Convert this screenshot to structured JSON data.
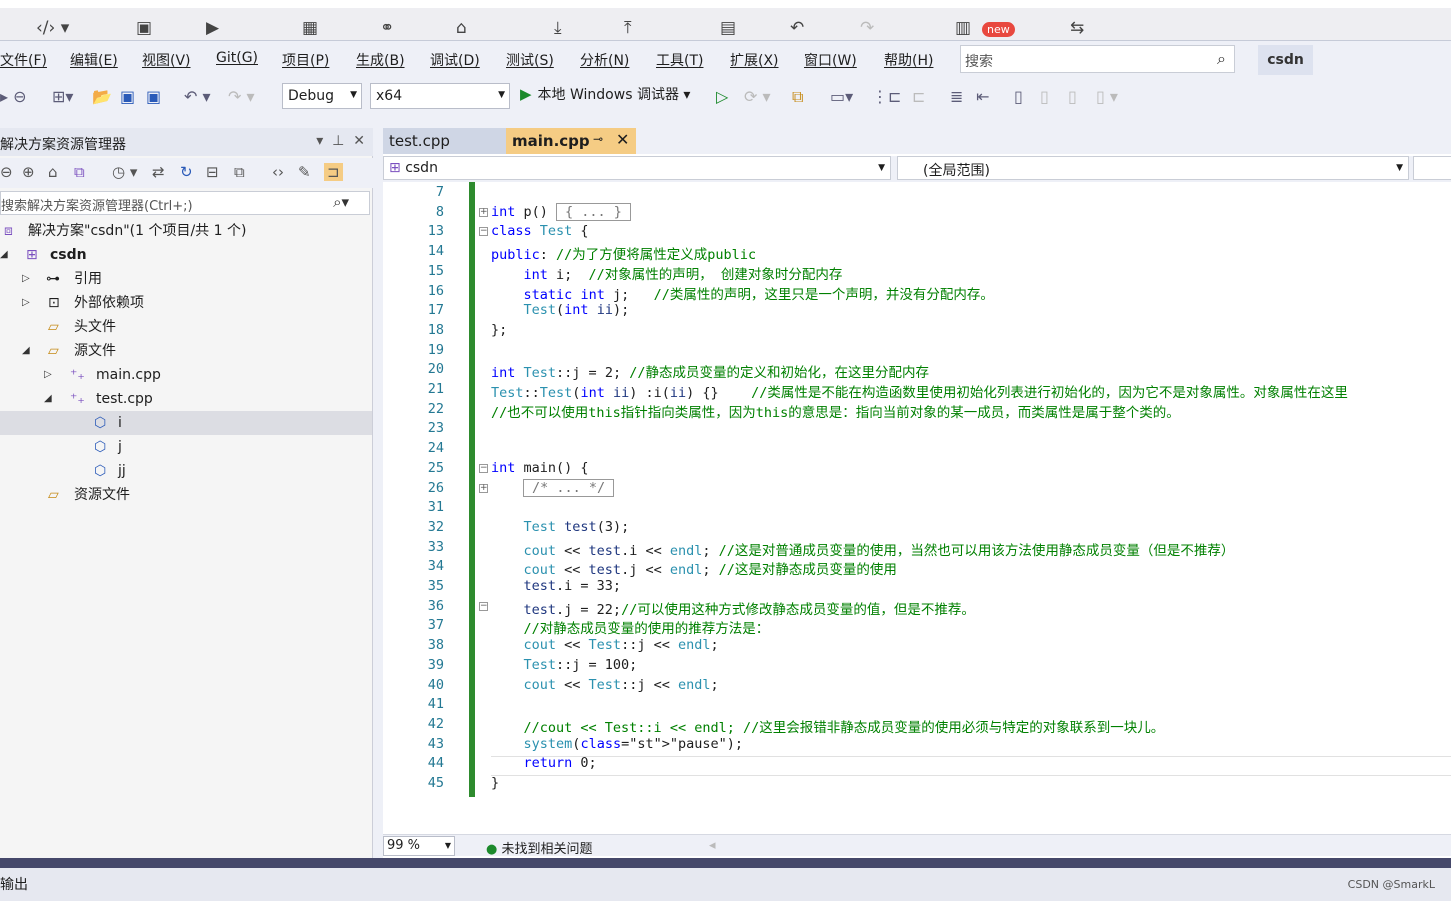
{
  "menu": [
    "文件(F)",
    "编辑(E)",
    "视图(V)",
    "Git(G)",
    "项目(P)",
    "生成(B)",
    "调试(D)",
    "测试(S)",
    "分析(N)",
    "工具(T)",
    "扩展(X)",
    "窗口(W)",
    "帮助(H)"
  ],
  "badge_new": "new",
  "search_placeholder": "搜索",
  "profile": "csdn",
  "toolbar": {
    "config": "Debug",
    "platform": "x64",
    "run_label": "本地 Windows 调试器"
  },
  "solution": {
    "title": "解决方案资源管理器",
    "search_placeholder": "搜索解决方案资源管理器(Ctrl+;)",
    "items": [
      "解决方案\"csdn\"(1 个项目/共 1 个)",
      "csdn",
      "引用",
      "外部依赖项",
      "头文件",
      "源文件",
      "main.cpp",
      "test.cpp",
      "i",
      "j",
      "jj",
      "资源文件"
    ]
  },
  "tabs": [
    "test.cpp",
    "main.cpp"
  ],
  "nav": {
    "project": "csdn",
    "scope": "(全局范围)"
  },
  "code_lines": [
    {
      "n": "7",
      "t": ""
    },
    {
      "n": "8",
      "t": "int p()"
    },
    {
      "n": "13",
      "t": "class Test {"
    },
    {
      "n": "14",
      "t": "public: //为了方便将属性定义成public"
    },
    {
      "n": "15",
      "t": "    int i;  //对象属性的声明， 创建对象时分配内存"
    },
    {
      "n": "16",
      "t": "    static int j;   //类属性的声明，这里只是一个声明，并没有分配内存。"
    },
    {
      "n": "17",
      "t": "    Test(int ii);"
    },
    {
      "n": "18",
      "t": "};"
    },
    {
      "n": "19",
      "t": ""
    },
    {
      "n": "20",
      "t": "int Test::j = 2; //静态成员变量的定义和初始化，在这里分配内存"
    },
    {
      "n": "21",
      "t": "Test::Test(int ii) :i(ii) {}    //类属性是不能在构造函数里使用初始化列表进行初始化的，因为它不是对象属性。对象属性在这里"
    },
    {
      "n": "22",
      "t": "//也不可以使用this指针指向类属性，因为this的意思是：指向当前对象的某一成员，而类属性是属于整个类的。"
    },
    {
      "n": "23",
      "t": ""
    },
    {
      "n": "24",
      "t": ""
    },
    {
      "n": "25",
      "t": "int main() {"
    },
    {
      "n": "26",
      "t": "    /* ... */"
    },
    {
      "n": "31",
      "t": ""
    },
    {
      "n": "32",
      "t": "    Test test(3);"
    },
    {
      "n": "33",
      "t": "    cout << test.i << endl; //这是对普通成员变量的使用，当然也可以用该方法使用静态成员变量（但是不推荐）"
    },
    {
      "n": "34",
      "t": "    cout << test.j << endl; //这是对静态成员变量的使用"
    },
    {
      "n": "35",
      "t": "    test.i = 33;"
    },
    {
      "n": "36",
      "t": "    test.j = 22;//可以使用这种方式修改静态成员变量的值，但是不推荐。"
    },
    {
      "n": "37",
      "t": "    //对静态成员变量的使用的推荐方法是："
    },
    {
      "n": "38",
      "t": "    cout << Test::j << endl;"
    },
    {
      "n": "39",
      "t": "    Test::j = 100;"
    },
    {
      "n": "40",
      "t": "    cout << Test::j << endl;"
    },
    {
      "n": "41",
      "t": ""
    },
    {
      "n": "42",
      "t": "    //cout << Test::i << endl; //这里会报错非静态成员变量的使用必须与特定的对象联系到一块儿。"
    },
    {
      "n": "43",
      "t": "    system(\"pause\");"
    },
    {
      "n": "44",
      "t": "    return 0;"
    },
    {
      "n": "45",
      "t": "}"
    }
  ],
  "collapsed_p": "{ ... }",
  "status": {
    "zoom": "99 %",
    "issues": "未找到相关问题"
  },
  "bottom_panel": "输出",
  "watermark": "CSDN @SmarkL"
}
